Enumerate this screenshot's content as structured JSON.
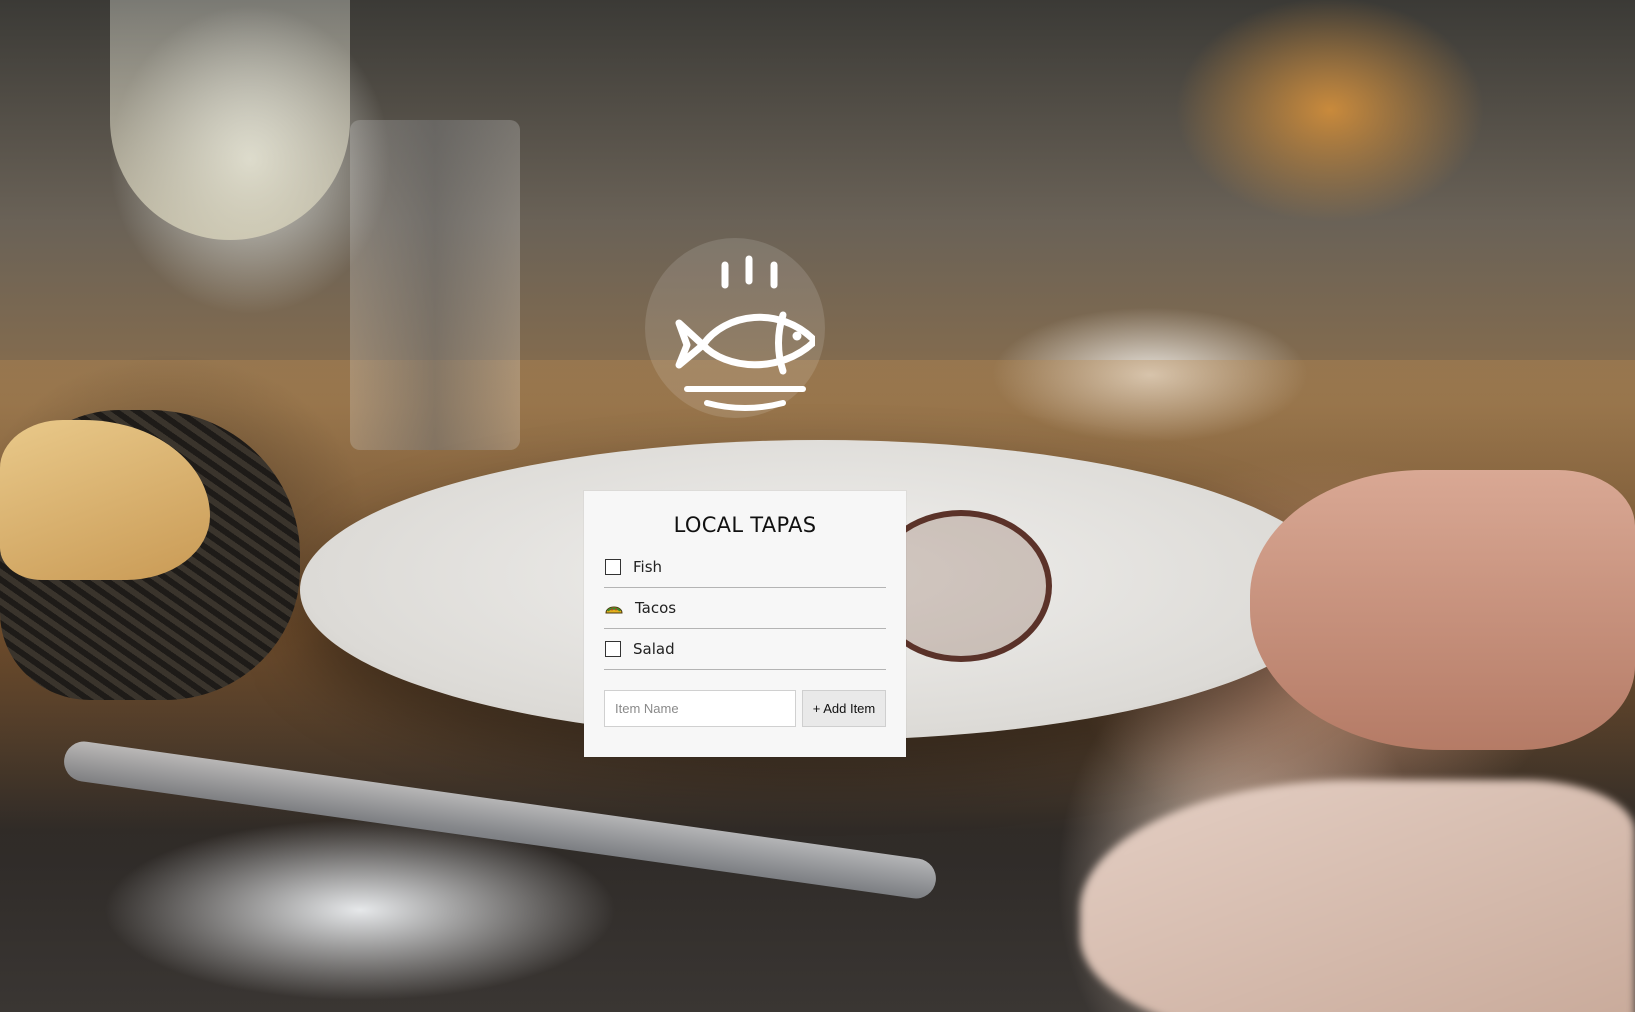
{
  "app": {
    "title": "LOCAL TAPAS",
    "logo_icon": "steaming-fish-on-plate-icon"
  },
  "items": [
    {
      "label": "Fish",
      "checked": false,
      "icon": "checkbox-empty"
    },
    {
      "label": "Tacos",
      "checked": true,
      "icon": "taco-icon"
    },
    {
      "label": "Salad",
      "checked": false,
      "icon": "checkbox-empty"
    }
  ],
  "form": {
    "input_placeholder": "Item Name",
    "input_value": "",
    "add_button_label": "+ Add Item"
  },
  "colors": {
    "card_background": "#f7f7f7",
    "divider": "#b4b4b4",
    "taco_shell": "#e3b11c",
    "taco_filling": "#3d8a2a"
  }
}
